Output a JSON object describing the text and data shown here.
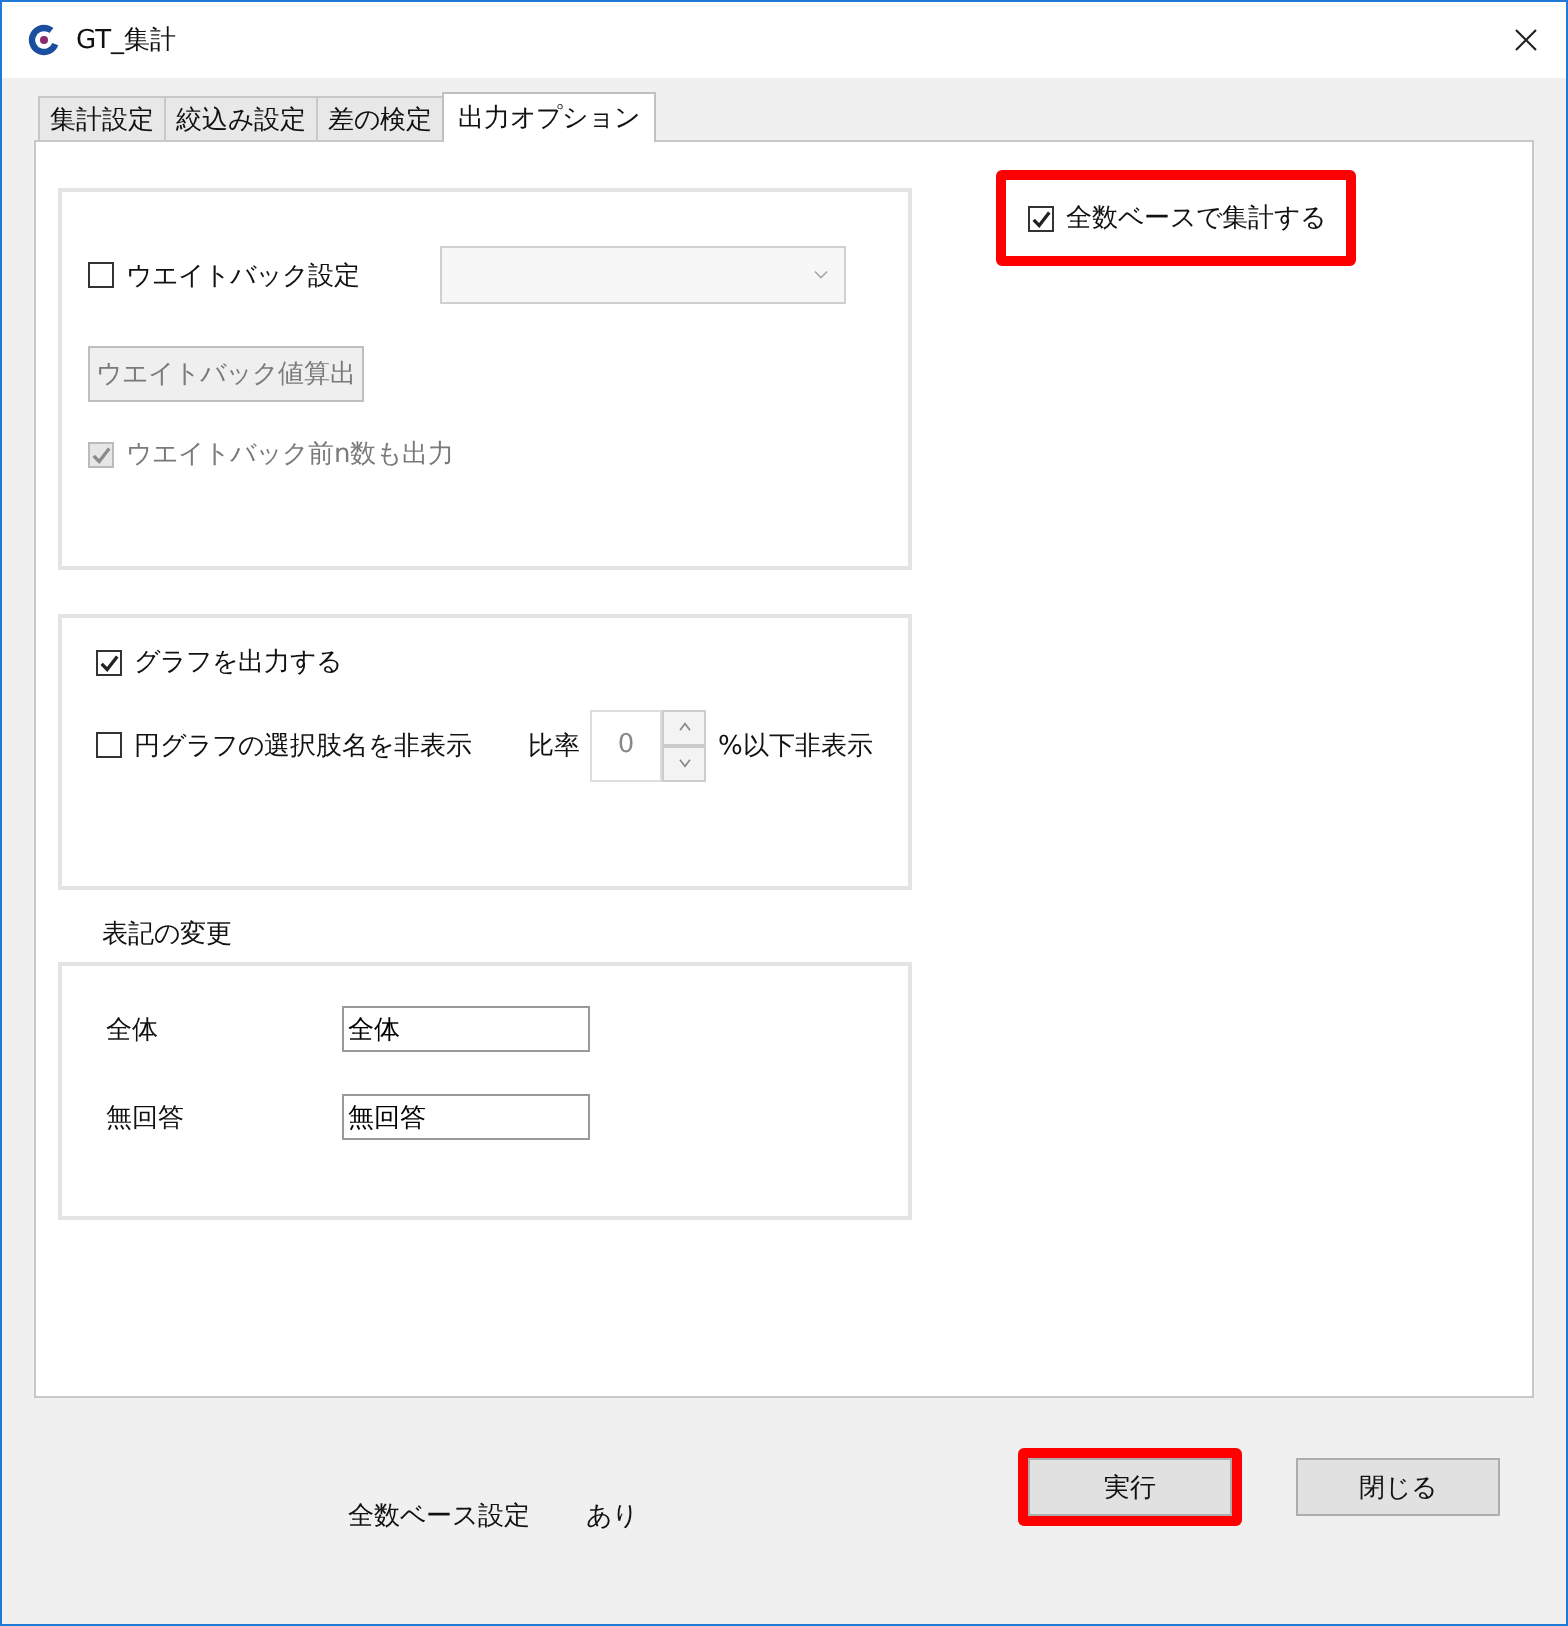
{
  "window": {
    "title": "GT_集計"
  },
  "tabs": [
    {
      "label": "集計設定",
      "selected": false
    },
    {
      "label": "絞込み設定",
      "selected": false
    },
    {
      "label": "差の検定",
      "selected": false
    },
    {
      "label": "出力オプション",
      "selected": true
    }
  ],
  "weight_back": {
    "checkbox": {
      "label": "ウエイトバック設定",
      "checked": false
    },
    "dropdown": {
      "disabled": true
    },
    "calc_button": {
      "label": "ウエイトバック値算出",
      "disabled": true
    },
    "pre_n_checkbox": {
      "label": "ウエイトバック前n数も出力",
      "checked": true,
      "disabled": true
    }
  },
  "graph": {
    "output_checkbox": {
      "label": "グラフを出力する",
      "checked": true
    },
    "hide_labels_checkbox": {
      "label": "円グラフの選択肢名を非表示",
      "checked": false
    },
    "ratio": {
      "label": "比率",
      "value": "0",
      "suffix": "%以下非表示",
      "disabled": true
    }
  },
  "notation": {
    "title": "表記の変更",
    "fields": [
      {
        "label": "全体",
        "value": "全体"
      },
      {
        "label": "無回答",
        "value": "無回答"
      }
    ]
  },
  "full_base_checkbox": {
    "label": "全数ベースで集計する",
    "checked": true,
    "highlighted": true
  },
  "status": {
    "label": "全数ベース設定",
    "value": "あり"
  },
  "buttons": [
    {
      "label": "実行",
      "highlighted": true
    },
    {
      "label": "閉じる",
      "highlighted": false
    }
  ]
}
